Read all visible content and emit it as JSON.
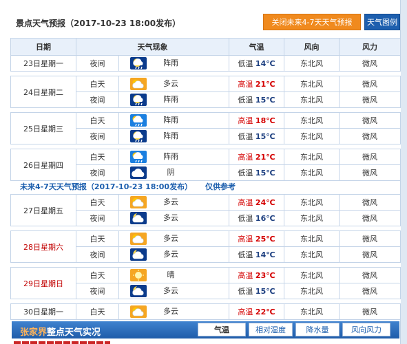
{
  "header": {
    "title": "景点天气预报（2017-10-23  18:00发布）",
    "close_future_btn": "关闭未来4-7天天气预报",
    "weather_map_btn": "天气图例"
  },
  "columns": [
    "日期",
    "天气现象",
    "气温",
    "风向",
    "风力"
  ],
  "colors": {
    "accent": "#1d5fae",
    "orange": "#f08a1e",
    "high_temp": "#d40000",
    "weekend": "#c20000"
  },
  "section1": [
    {
      "date": "23日星期一",
      "red": false,
      "rows": [
        {
          "period": "夜间",
          "icon": "night-rain-icon",
          "weather": "阵雨",
          "temp_label": "低温",
          "temp": "14℃",
          "high": false,
          "wind_dir": "东北风",
          "wind_force": "微风"
        }
      ]
    },
    {
      "date": "24日星期二",
      "red": false,
      "rows": [
        {
          "period": "白天",
          "icon": "partly-cloudy-day-icon",
          "weather": "多云",
          "temp_label": "高温",
          "temp": "21℃",
          "high": true,
          "wind_dir": "东北风",
          "wind_force": "微风"
        },
        {
          "period": "夜间",
          "icon": "night-rain-icon",
          "weather": "阵雨",
          "temp_label": "低温",
          "temp": "15℃",
          "high": false,
          "wind_dir": "东北风",
          "wind_force": "微风"
        }
      ]
    },
    {
      "date": "25日星期三",
      "red": false,
      "rows": [
        {
          "period": "白天",
          "icon": "day-rain-icon",
          "weather": "阵雨",
          "temp_label": "高温",
          "temp": "18℃",
          "high": true,
          "wind_dir": "东北风",
          "wind_force": "微风"
        },
        {
          "period": "夜间",
          "icon": "night-rain-icon",
          "weather": "阵雨",
          "temp_label": "低温",
          "temp": "15℃",
          "high": false,
          "wind_dir": "东北风",
          "wind_force": "微风"
        }
      ]
    },
    {
      "date": "26日星期四",
      "red": false,
      "rows": [
        {
          "period": "白天",
          "icon": "day-rain-icon",
          "weather": "阵雨",
          "temp_label": "高温",
          "temp": "21℃",
          "high": true,
          "wind_dir": "东北风",
          "wind_force": "微风"
        },
        {
          "period": "夜间",
          "icon": "overcast-icon",
          "weather": "阴",
          "temp_label": "低温",
          "temp": "15℃",
          "high": false,
          "wind_dir": "东北风",
          "wind_force": "微风"
        }
      ]
    }
  ],
  "future": {
    "title": "未来4-7天天气预报（2017-10-23 18:00发布）",
    "note": "仅供参考"
  },
  "section2": [
    {
      "date": "27日星期五",
      "red": false,
      "rows": [
        {
          "period": "白天",
          "icon": "partly-cloudy-day-icon",
          "weather": "多云",
          "temp_label": "高温",
          "temp": "24℃",
          "high": true,
          "wind_dir": "东北风",
          "wind_force": "微风"
        },
        {
          "period": "夜间",
          "icon": "partly-cloudy-night-icon",
          "weather": "多云",
          "temp_label": "低温",
          "temp": "16℃",
          "high": false,
          "wind_dir": "东北风",
          "wind_force": "微风"
        }
      ]
    },
    {
      "date": "28日星期六",
      "red": true,
      "rows": [
        {
          "period": "白天",
          "icon": "partly-cloudy-day-icon",
          "weather": "多云",
          "temp_label": "高温",
          "temp": "25℃",
          "high": true,
          "wind_dir": "东北风",
          "wind_force": "微风"
        },
        {
          "period": "夜间",
          "icon": "partly-cloudy-night-icon",
          "weather": "多云",
          "temp_label": "低温",
          "temp": "14℃",
          "high": false,
          "wind_dir": "东北风",
          "wind_force": "微风"
        }
      ]
    },
    {
      "date": "29日星期日",
      "red": true,
      "rows": [
        {
          "period": "白天",
          "icon": "sunny-icon",
          "weather": "晴",
          "temp_label": "高温",
          "temp": "23℃",
          "high": true,
          "wind_dir": "东北风",
          "wind_force": "微风"
        },
        {
          "period": "夜间",
          "icon": "partly-cloudy-night-icon",
          "weather": "多云",
          "temp_label": "低温",
          "temp": "15℃",
          "high": false,
          "wind_dir": "东北风",
          "wind_force": "微风"
        }
      ]
    },
    {
      "date": "30日星期一",
      "red": false,
      "rows": [
        {
          "period": "白天",
          "icon": "partly-cloudy-day-icon",
          "weather": "多云",
          "temp_label": "高温",
          "temp": "22℃",
          "high": true,
          "wind_dir": "东北风",
          "wind_force": "微风"
        }
      ]
    }
  ],
  "footer": {
    "title_accent": "张家界",
    "title_rest": "整点天气实况",
    "tabs": [
      "气温",
      "相对湿度",
      "降水量",
      "风向风力"
    ]
  }
}
